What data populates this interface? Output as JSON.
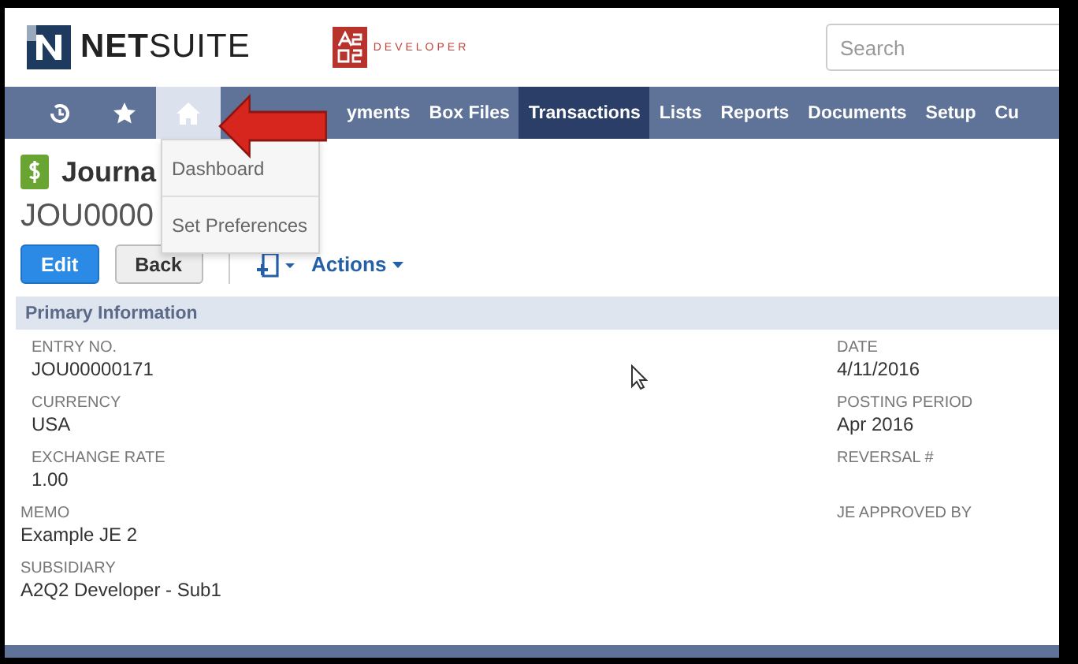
{
  "logo": {
    "text": "**NET**SUITE"
  },
  "partner_logo": {
    "text": "DEVELOPER"
  },
  "search": {
    "placeholder": "Search"
  },
  "nav": {
    "icons": [
      {
        "kind": "recent",
        "selected": false
      },
      {
        "kind": "star",
        "selected": false
      },
      {
        "kind": "home",
        "selected": true
      }
    ],
    "items": [
      {
        "label": "yments",
        "selected": false
      },
      {
        "label": "Box Files",
        "selected": false
      },
      {
        "label": "Transactions",
        "selected": true
      },
      {
        "label": "Lists",
        "selected": false
      },
      {
        "label": "Reports",
        "selected": false
      },
      {
        "label": "Documents",
        "selected": false
      },
      {
        "label": "Setup",
        "selected": false
      },
      {
        "label": "Cu",
        "selected": false
      }
    ]
  },
  "menu": {
    "items": [
      "Dashboard",
      "Set Preferences"
    ]
  },
  "page": {
    "title": "Journa",
    "record_id": "JOU0000"
  },
  "buttons": [
    {
      "label": "Edit",
      "kind": "primary"
    },
    {
      "label": "Back",
      "kind": "secondary"
    }
  ],
  "actions": {
    "label": "Actions"
  },
  "section": {
    "title": "Primary Information"
  },
  "fields_left": [
    {
      "label": "ENTRY NO.",
      "value": "JOU00000171"
    },
    {
      "label": "CURRENCY",
      "value": "USA"
    },
    {
      "label": "EXCHANGE RATE",
      "value": "1.00"
    }
  ],
  "fields_lower": [
    {
      "label": "MEMO",
      "value": "Example JE 2"
    },
    {
      "label": "SUBSIDIARY",
      "value": "A2Q2 Developer - Sub1"
    }
  ],
  "fields_right": [
    {
      "label": "DATE",
      "value": "4/11/2016"
    },
    {
      "label": "POSTING PERIOD",
      "value": "Apr 2016"
    },
    {
      "label": "REVERSAL #"
    },
    {
      "label": "JE APPROVED BY"
    }
  ]
}
